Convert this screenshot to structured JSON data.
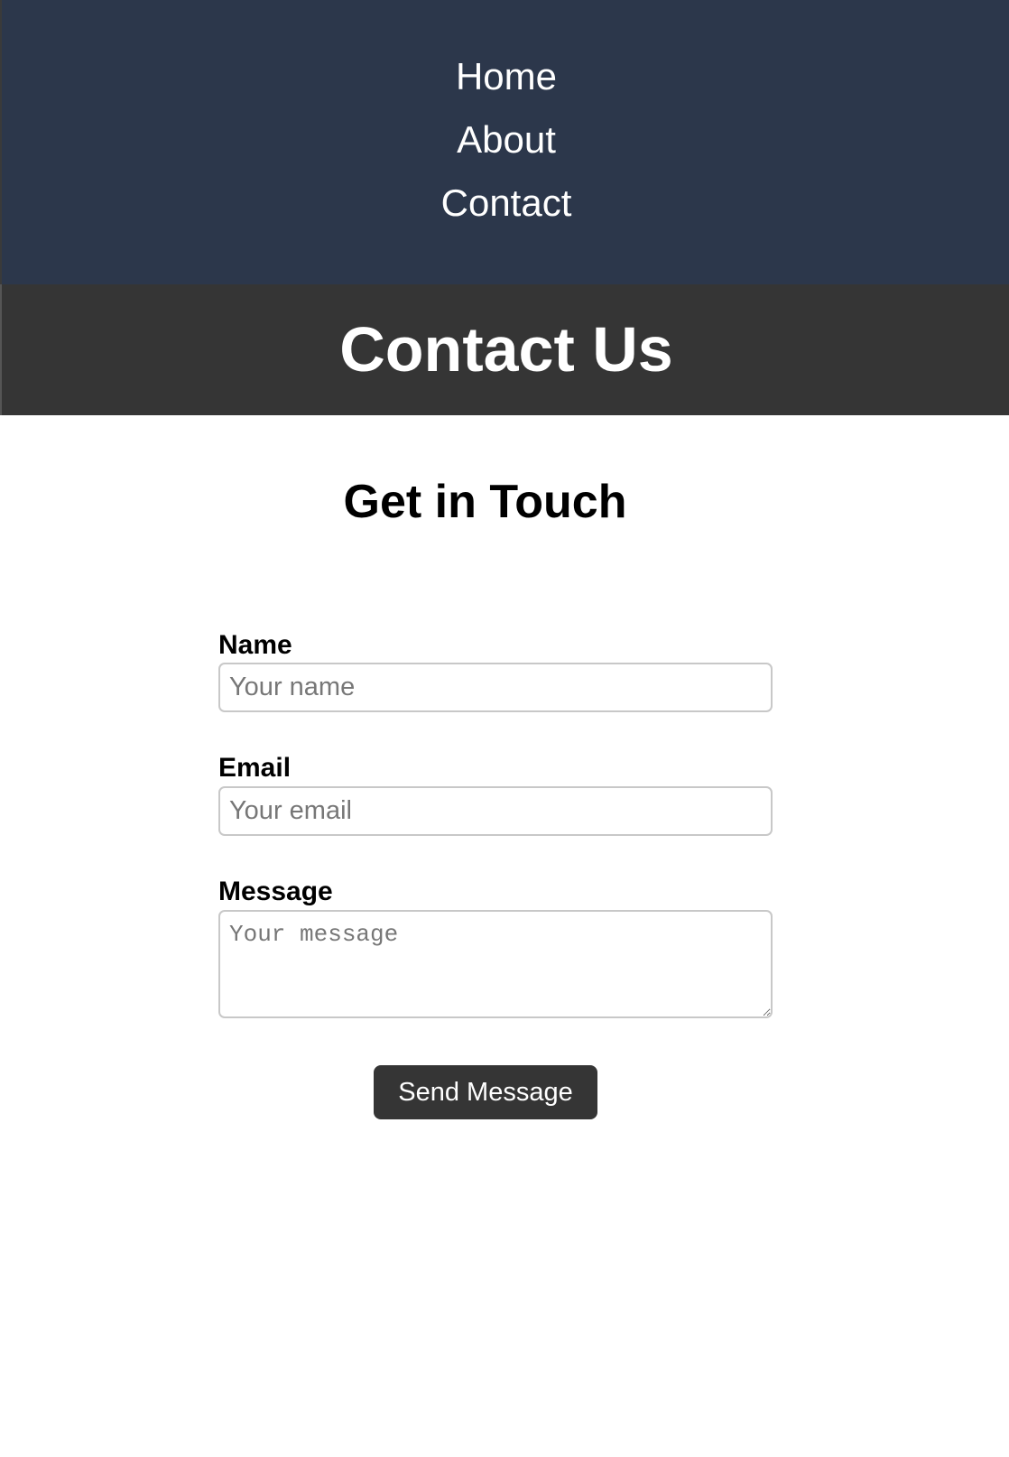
{
  "nav": {
    "items": [
      {
        "label": "Home"
      },
      {
        "label": "About"
      },
      {
        "label": "Contact"
      }
    ],
    "background_color": "#2c374b"
  },
  "hero": {
    "title": "Contact Us",
    "background_color": "#353535"
  },
  "main": {
    "heading": "Get in Touch"
  },
  "form": {
    "name": {
      "label": "Name",
      "placeholder": "Your name",
      "value": ""
    },
    "email": {
      "label": "Email",
      "placeholder": "Your email",
      "value": ""
    },
    "message": {
      "label": "Message",
      "placeholder": "Your message",
      "value": ""
    },
    "submit_label": "Send Message",
    "submit_color": "#353535"
  }
}
